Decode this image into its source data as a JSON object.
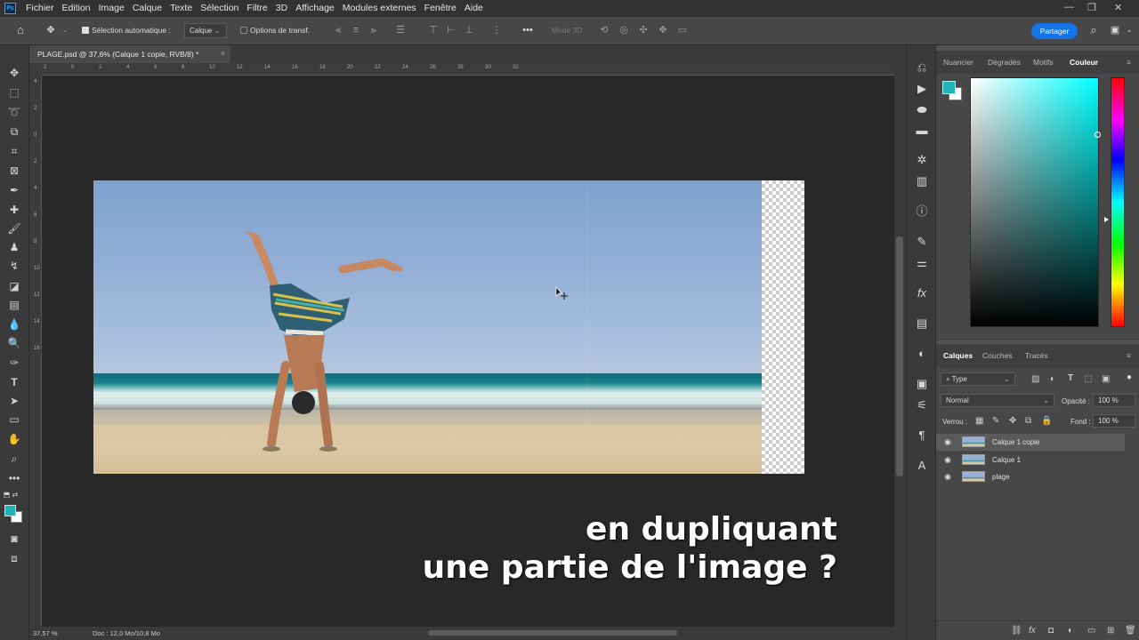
{
  "menubar": {
    "logo": "Ps",
    "items": [
      "Fichier",
      "Edition",
      "Image",
      "Calque",
      "Texte",
      "Sélection",
      "Filtre",
      "3D",
      "Affichage",
      "Modules externes",
      "Fenêtre",
      "Aide"
    ],
    "window_controls": {
      "minimize": "—",
      "restore": "❐",
      "close": "✕"
    }
  },
  "options": {
    "auto_select_label": "Sélection automatique :",
    "auto_select_target": "Calque",
    "transform_label": "Options de transf.",
    "mode_3d_label": "Mode 3D",
    "share_label": "Partager"
  },
  "document": {
    "tab_title": "PLAGE.psd @ 37,6% (Calque 1 copie, RVB/8) *",
    "close": "×"
  },
  "rulers": {
    "top": [
      "2",
      "0",
      "2",
      "4",
      "6",
      "8",
      "10",
      "12",
      "14",
      "16",
      "18",
      "20",
      "22",
      "24",
      "26",
      "28",
      "30",
      "32"
    ],
    "left": [
      "4",
      "2",
      "0",
      "2",
      "4",
      "6",
      "8",
      "10",
      "12",
      "14",
      "16"
    ]
  },
  "status": {
    "zoom": "37,57 %",
    "doc": "Doc : 12,0 Mo/10,8 Mo"
  },
  "subtitle": {
    "line1": "en dupliquant",
    "line2": "une partie de l'image ?"
  },
  "color_panel": {
    "tabs": [
      "Nuancier",
      "Dégradés",
      "Motifs",
      "Couleur"
    ],
    "active_tab": "Couleur",
    "foreground": "#1fb4b8",
    "background": "#ffffff"
  },
  "layers_panel": {
    "tabs": [
      "Calques",
      "Couches",
      "Tracés"
    ],
    "active_tab": "Calques",
    "filter_label": "Type",
    "blend_mode": "Normal",
    "opacity_label": "Opacité :",
    "opacity_value": "100 %",
    "lock_label": "Verrou :",
    "fill_label": "Fond :",
    "fill_value": "100 %",
    "layers": [
      {
        "name": "Calque 1 copie",
        "selected": true
      },
      {
        "name": "Calque 1",
        "selected": false
      },
      {
        "name": "plage",
        "selected": false
      }
    ]
  }
}
